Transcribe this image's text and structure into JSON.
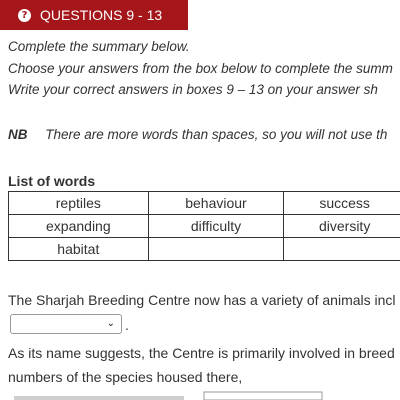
{
  "header": {
    "icon": "question-circle-icon",
    "icon_glyph": "?",
    "title": "QUESTIONS 9 - 13",
    "color": "#a5161b"
  },
  "instructions": [
    "Complete the summary below.",
    "Choose your answers from the box below to complete the summ",
    "Write your correct answers in boxes 9 – 13 on your answer sh"
  ],
  "nb": {
    "label": "NB",
    "text": "There are more words than spaces, so you will not use th"
  },
  "word_list": {
    "title": "List of words",
    "rows": [
      [
        "reptiles",
        "behaviour",
        "success"
      ],
      [
        "expanding",
        "difficulty",
        "diversity"
      ],
      [
        "habitat",
        "",
        ""
      ]
    ]
  },
  "summary": {
    "line1": "The Sharjah Breeding Centre now has a variety of animals incl",
    "select_value": "",
    "period": ".",
    "line2": "As its name suggests, the Centre is primarily involved in breed",
    "line3": "numbers of the species housed there,"
  }
}
